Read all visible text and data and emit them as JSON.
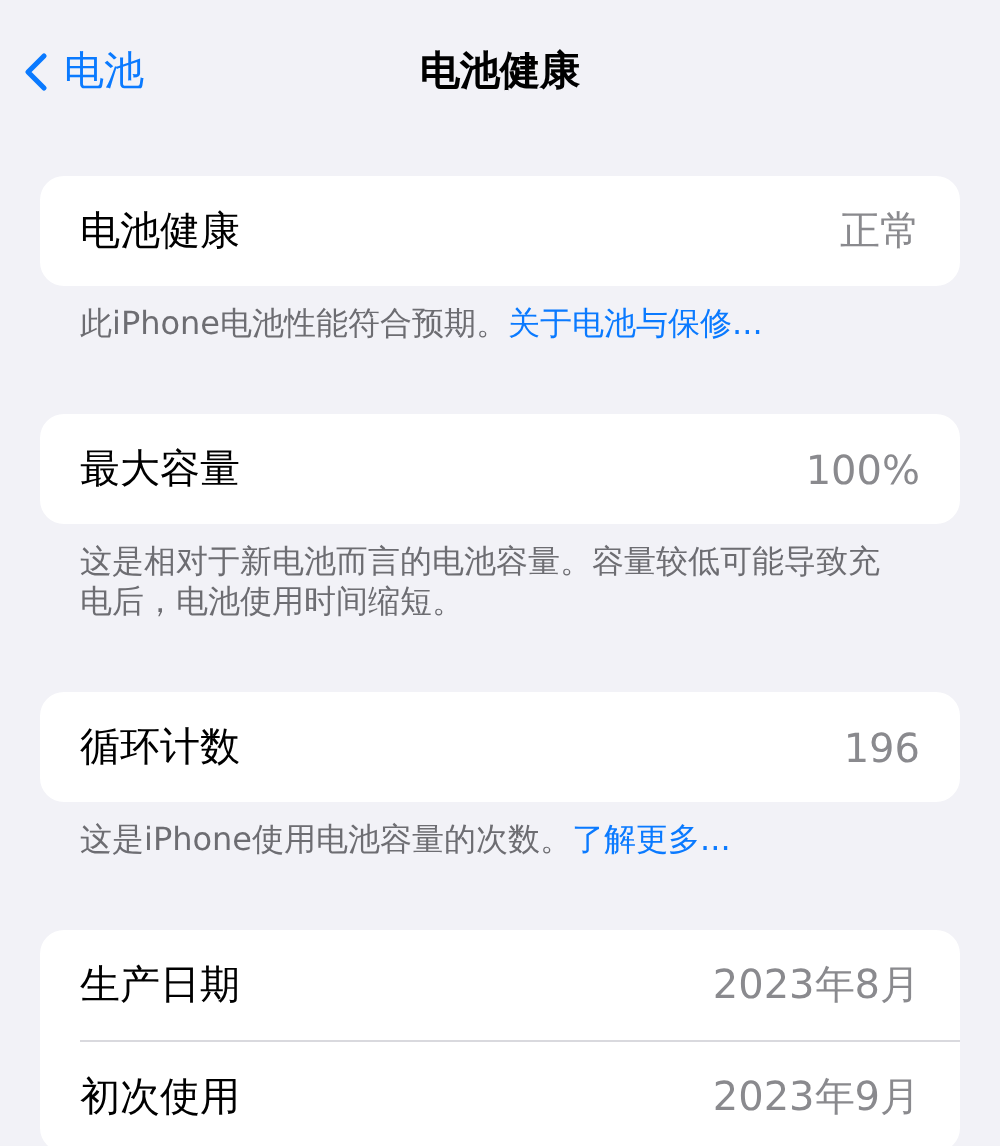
{
  "nav": {
    "back_label": "电池",
    "title": "电池健康"
  },
  "sections": [
    {
      "rows": [
        {
          "label": "电池健康",
          "value": "正常"
        }
      ],
      "footer": {
        "text": "此iPhone电池性能符合预期。",
        "link": "关于电池与保修..."
      }
    },
    {
      "rows": [
        {
          "label": "最大容量",
          "value": "100%"
        }
      ],
      "footer": {
        "text": "这是相对于新电池而言的电池容量。容量较低可能导致充电后，电池使用时间缩短。"
      }
    },
    {
      "rows": [
        {
          "label": "循环计数",
          "value": "196"
        }
      ],
      "footer": {
        "text": "这是iPhone使用电池容量的次数。",
        "link": "了解更多..."
      }
    },
    {
      "rows": [
        {
          "label": "生产日期",
          "value": "2023年8月"
        },
        {
          "label": "初次使用",
          "value": "2023年9月"
        }
      ]
    }
  ]
}
